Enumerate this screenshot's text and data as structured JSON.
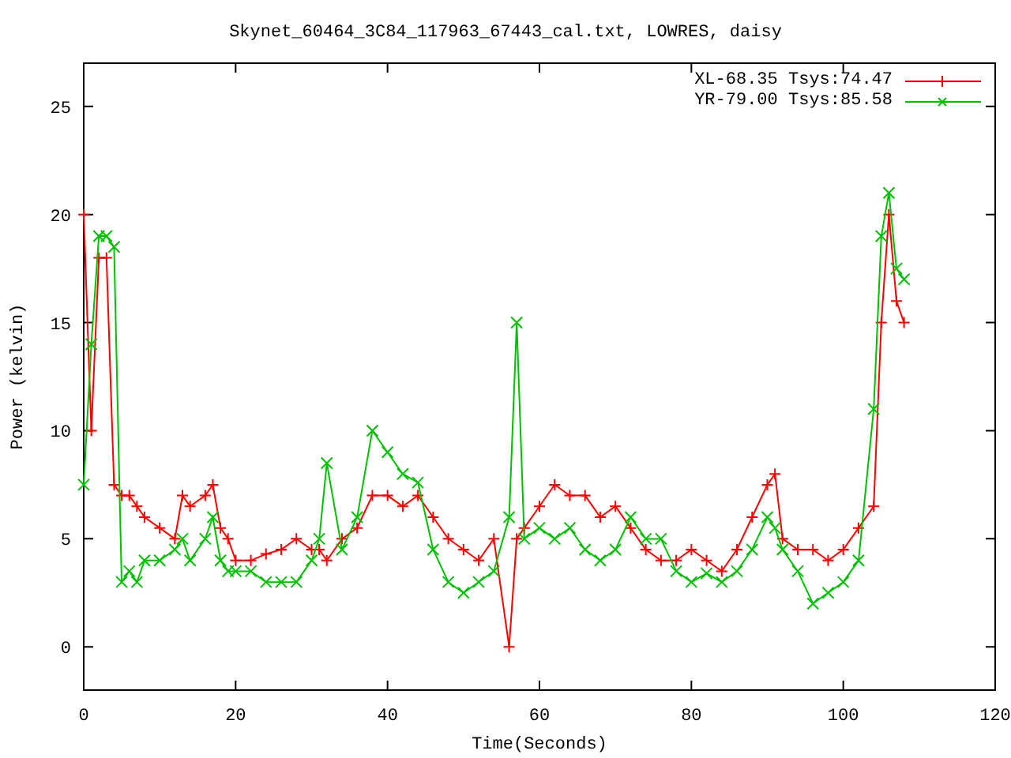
{
  "chart_data": {
    "type": "line",
    "title": "Skynet_60464_3C84_117963_67443_cal.txt, LOWRES, daisy",
    "xlabel": "Time(Seconds)",
    "ylabel": "Power (kelvin)",
    "x": [
      0,
      1,
      2,
      3,
      4,
      5,
      6,
      7,
      8,
      10,
      12,
      13,
      14,
      16,
      17,
      18,
      19,
      20,
      22,
      24,
      26,
      28,
      30,
      31,
      32,
      34,
      36,
      38,
      40,
      42,
      44,
      46,
      48,
      50,
      52,
      54,
      56,
      57,
      58,
      60,
      62,
      64,
      66,
      68,
      70,
      72,
      74,
      76,
      78,
      80,
      82,
      84,
      86,
      88,
      90,
      91,
      92,
      94,
      96,
      98,
      100,
      102,
      104,
      105,
      106,
      107,
      108
    ],
    "series": [
      {
        "name": "XL-68.35 Tsys:74.47",
        "color": "#ff0000",
        "marker": "plus",
        "values": [
          20,
          10,
          18,
          18,
          7.5,
          7,
          7,
          6.5,
          6,
          5.5,
          5,
          7,
          6.5,
          7,
          7.5,
          5.5,
          5,
          4,
          4,
          4.3,
          4.5,
          5,
          4.5,
          4.5,
          4,
          5,
          5.5,
          7,
          7,
          6.5,
          7,
          6,
          5,
          4.5,
          4,
          5,
          0,
          5,
          5.5,
          6.5,
          7.5,
          7,
          7,
          6,
          6.5,
          5.5,
          4.5,
          4,
          4,
          4.5,
          4,
          3.5,
          4.5,
          6,
          7.5,
          8,
          5,
          4.5,
          4.5,
          4,
          4.5,
          5.5,
          6.5,
          15,
          20,
          16,
          15
        ]
      },
      {
        "name": "YR-79.00 Tsys:85.58",
        "color": "#00c000",
        "marker": "cross",
        "values": [
          7.5,
          14,
          19,
          19,
          18.5,
          3,
          3.5,
          3,
          4,
          4,
          4.5,
          5,
          4,
          5,
          6,
          4,
          3.5,
          3.5,
          3.5,
          3,
          3,
          3,
          4,
          5,
          8.5,
          4.5,
          6,
          10,
          9,
          8,
          7.6,
          4.5,
          3,
          2.5,
          3,
          3.5,
          6,
          15,
          5,
          5.5,
          5,
          5.5,
          4.5,
          4,
          4.5,
          6,
          5,
          5,
          3.5,
          3,
          3.4,
          3,
          3.5,
          4.5,
          6,
          5.5,
          4.5,
          3.5,
          2,
          2.5,
          3,
          4,
          11,
          19,
          21,
          17.5,
          17
        ]
      }
    ],
    "xlim": [
      0,
      120
    ],
    "ylim": [
      -2,
      27
    ],
    "xticks": [
      0,
      20,
      40,
      60,
      80,
      100,
      120
    ],
    "yticks": [
      0,
      5,
      10,
      15,
      20,
      25
    ],
    "legend": "upper right"
  }
}
